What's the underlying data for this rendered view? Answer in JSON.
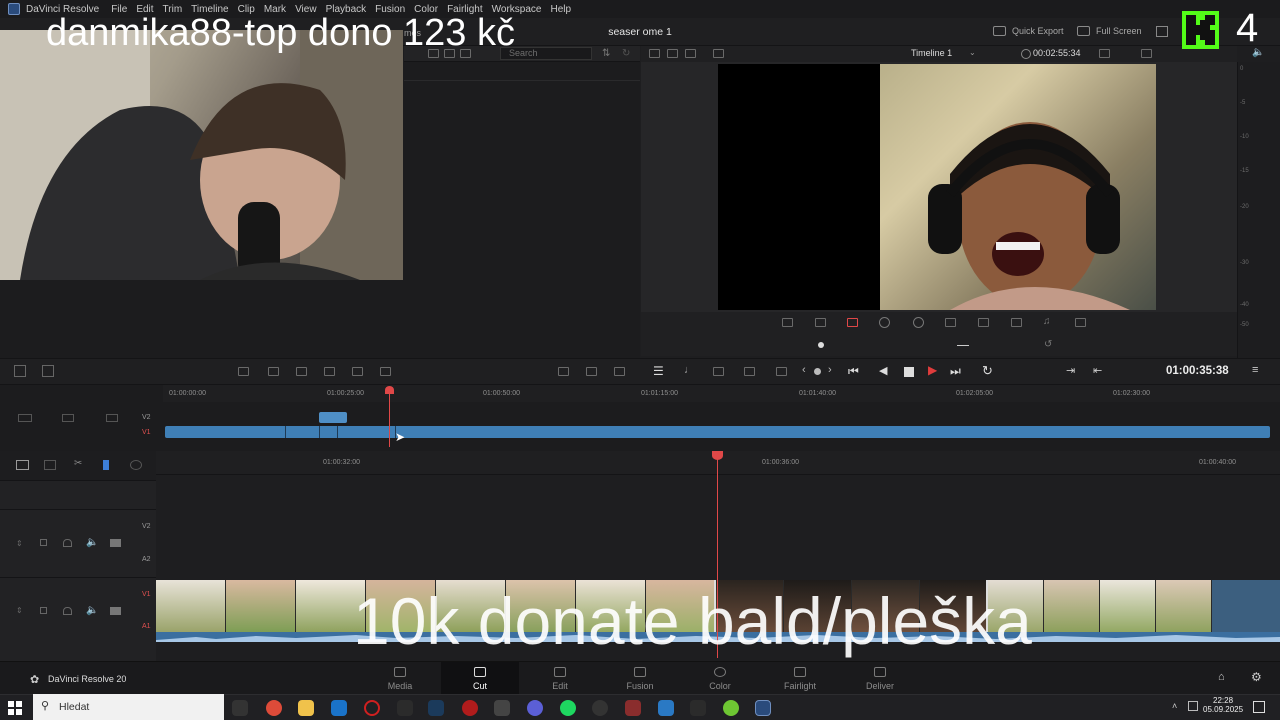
{
  "menubar": {
    "app_name": "DaVinci Resolve",
    "items": [
      "File",
      "Edit",
      "Trim",
      "Timeline",
      "Clip",
      "Mark",
      "View",
      "Playback",
      "Fusion",
      "Color",
      "Fairlight",
      "Workspace",
      "Help"
    ]
  },
  "toolbar": {
    "project_title": "seaser ome 1",
    "quick_export": "Quick Export",
    "full_screen": "Full Screen",
    "partial_tab": "mes"
  },
  "media_pool": {
    "search_placeholder": "Search"
  },
  "viewer": {
    "timeline_name": "Timeline 1",
    "duration": "00:02:55:34"
  },
  "audio_meter": {
    "ticks": [
      "0",
      "-5",
      "-10",
      "-15",
      "-20",
      "-30",
      "-40",
      "-50"
    ]
  },
  "transport": {
    "timecode": "01:00:35:38"
  },
  "upper_timeline": {
    "ruler_labels": [
      "01:00:00:00",
      "01:00:25:00",
      "01:00:50:00",
      "01:01:15:00",
      "01:01:40:00",
      "01:02:05:00",
      "01:02:30:00"
    ],
    "tracks": [
      "V2",
      "V1"
    ]
  },
  "lower_timeline": {
    "ruler_labels": [
      "01:00:32:00",
      "01:00:36:00",
      "01:00:40:00"
    ],
    "tracks": [
      "V2",
      "A2",
      "V1",
      "A1"
    ]
  },
  "pagebar": {
    "brand": "DaVinci Resolve 20",
    "pages": [
      "Media",
      "Cut",
      "Edit",
      "Fusion",
      "Color",
      "Fairlight",
      "Deliver"
    ],
    "active_page": "Cut"
  },
  "taskbar": {
    "search_label": "Hledat",
    "time": "22:28",
    "date": "05.09.2025"
  },
  "stream_overlay": {
    "top_text": "danmika88-top dono 123 kč",
    "bottom_text": "10k donate bald/pleška",
    "badge_number": "4",
    "badge_color": "#53fc18"
  },
  "colors": {
    "clip_blue": "#3f7fb6",
    "playhead_red": "#e04848",
    "active_play": "#e03c3c"
  }
}
